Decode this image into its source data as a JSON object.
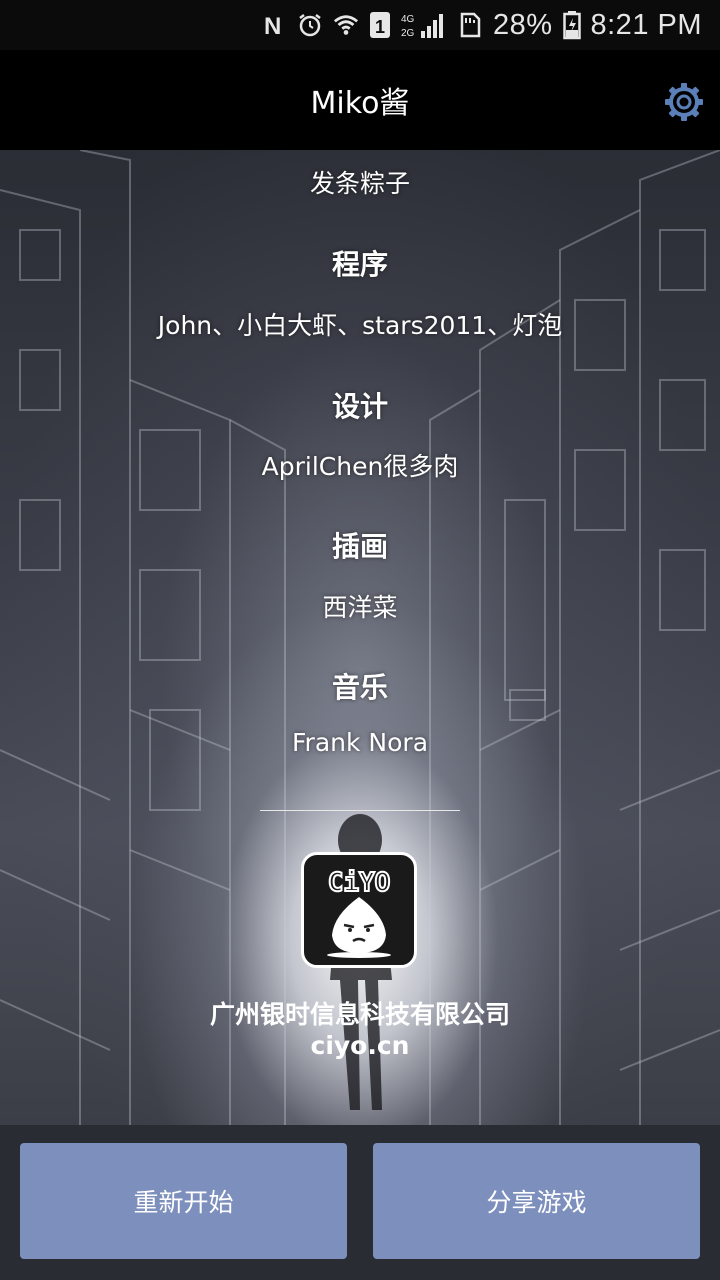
{
  "status_bar": {
    "battery_percent": "28%",
    "time": "8:21 PM",
    "sim_slot": "1",
    "network": "4G 2G",
    "icons": [
      "nfc-icon",
      "alarm-icon",
      "wifi-icon",
      "sim-icon",
      "signal-icon",
      "sd-card-icon",
      "battery-icon"
    ]
  },
  "app_bar": {
    "title": "Miko酱",
    "settings_icon": "gear-icon",
    "accent": "#5b7fb8"
  },
  "credits": {
    "intro_line": "发条粽子",
    "sections": [
      {
        "heading": "程序",
        "names": "John、小白大虾、stars2011、灯泡"
      },
      {
        "heading": "设计",
        "names": "AprilChen很多肉"
      },
      {
        "heading": "插画",
        "names": "西洋菜"
      },
      {
        "heading": "音乐",
        "names": "Frank Nora"
      }
    ]
  },
  "company": {
    "logo_text": "CiYO",
    "name": "广州银时信息科技有限公司",
    "website": "ciyo.cn"
  },
  "buttons": {
    "restart_label": "重新开始",
    "share_label": "分享游戏",
    "color": "#7d8fbd"
  }
}
